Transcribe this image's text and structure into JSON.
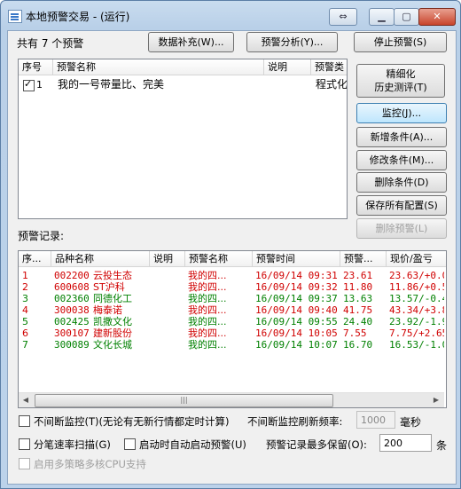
{
  "window": {
    "title": "本地预警交易 - (运行)",
    "restore_icon": "swap-arrows-icon"
  },
  "top": {
    "count_label": "共有 7 个预警",
    "btn_data_fill": "数据补充(W)...",
    "btn_analysis": "预警分析(Y)...",
    "btn_stop": "停止预警(S)"
  },
  "strategy_list": {
    "columns": [
      "序号",
      "预警名称",
      "说明",
      "预警类"
    ],
    "rows": [
      {
        "checked": true,
        "index": "1",
        "name": "我的一号带量比、完美",
        "desc": "",
        "type": "程式化"
      }
    ]
  },
  "side_buttons": {
    "fine_line1": "精细化",
    "fine_line2": "历史测评(T)",
    "monitor": "监控(J)...",
    "add_condition": "新增条件(A)...",
    "modify_condition": "修改条件(M)...",
    "delete_condition": "删除条件(D)",
    "save_config": "保存所有配置(S)",
    "delete_alert": "删除预警(L)"
  },
  "records_label": "预警记录:",
  "records": {
    "columns": [
      "序...",
      "品种名称",
      "说明",
      "预警名称",
      "预警时间",
      "预警...",
      "现价/盈亏"
    ],
    "rows": [
      {
        "no": "1",
        "code": "002200",
        "name": "云投生态",
        "alert": "我的四...",
        "time": "16/09/14 09:31",
        "price": "23.61",
        "pnl": "23.63/+0.0",
        "color": "#d00000"
      },
      {
        "no": "2",
        "code": "600608",
        "name": "ST沪科",
        "alert": "我的四...",
        "time": "16/09/14 09:32",
        "price": "11.80",
        "pnl": "11.86/+0.5",
        "color": "#d00000"
      },
      {
        "no": "3",
        "code": "002360",
        "name": "同德化工",
        "alert": "我的四...",
        "time": "16/09/14 09:37",
        "price": "13.63",
        "pnl": "13.57/-0.4",
        "color": "#008000"
      },
      {
        "no": "4",
        "code": "300038",
        "name": "梅泰诺",
        "alert": "我的四...",
        "time": "16/09/14 09:40",
        "price": "41.75",
        "pnl": "43.34/+3.8",
        "color": "#d00000"
      },
      {
        "no": "5",
        "code": "002425",
        "name": "凯撒文化",
        "alert": "我的四...",
        "time": "16/09/14 09:55",
        "price": "24.40",
        "pnl": "23.92/-1.9",
        "color": "#008000"
      },
      {
        "no": "6",
        "code": "300107",
        "name": "建新股份",
        "alert": "我的四...",
        "time": "16/09/14 10:05",
        "price": "7.55",
        "pnl": "7.75/+2.65",
        "color": "#d00000"
      },
      {
        "no": "7",
        "code": "300089",
        "name": "文化长城",
        "alert": "我的四...",
        "time": "16/09/14 10:07",
        "price": "16.70",
        "pnl": "16.53/-1.0",
        "color": "#008000"
      }
    ]
  },
  "options": {
    "continuous_monitor": "不间断监控(T)(无论有无新行情都定时计算)",
    "refresh_rate_label": "不间断监控刷新频率:",
    "refresh_rate_value": "1000",
    "refresh_unit": "毫秒",
    "tick_scan": "分笔速率扫描(G)",
    "auto_start": "启动时自动启动预警(U)",
    "max_records_label": "预警记录最多保留(O):",
    "max_records_value": "200",
    "max_records_unit": "条",
    "multi_core": "启用多策略多核CPU支持"
  }
}
